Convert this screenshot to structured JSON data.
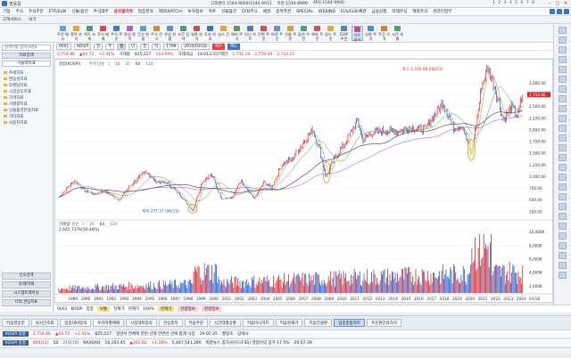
{
  "titlebar": {
    "title": "영웅문",
    "service_info": [
      "고객센터 1544-9000/1544-9911",
      "주문 1544-8989",
      "ARS 1544-9900"
    ],
    "win_numbers": "1 2 3 4 5 6 7 8"
  },
  "menu": [
    "기업",
    "주식",
    "주식주문",
    "ETF/ELW",
    "선물/옵션",
    "주식대주",
    "글로벌마켓",
    "업종분석",
    "해외(KATCH)",
    "투자정보",
    "차트",
    "선물옵션",
    "CFD주식",
    "채권",
    "종목추천",
    "SPECIAL",
    "WEBIND",
    "ELS/ELB/채권",
    "금융상품",
    "미래주식",
    "해외주식",
    "온라인업무"
  ],
  "menu_hot": "글로벌마켓",
  "subbar": [
    "고객서비스",
    "보기"
  ],
  "toolbar": [
    {
      "label": "주간\n메뉴",
      "color": "#6aa0e0"
    },
    {
      "label": "종목\n분석",
      "color": "#e6a13b"
    },
    {
      "label": "차트\n조회",
      "color": "#49a36b"
    },
    {
      "label": "주식\n매매",
      "color": "#d34c4c"
    },
    {
      "label": "주식\n주문",
      "color": "#3d7bd0"
    },
    {
      "label": "관심\n종목",
      "color": "#9b6bd2"
    },
    {
      "label": "잔고\n현황",
      "color": "#5aa5c2"
    },
    {
      "label": "주식\n잔고",
      "color": "#d58a3a"
    },
    {
      "label": "관심\n현황",
      "color": "#5e8fd1"
    },
    {
      "label": "조건\n검색",
      "color": "#48a07a"
    },
    {
      "label": "영웅\n분석",
      "color": "#c35353"
    },
    {
      "label": "투자\n자료",
      "color": "#3f74c4"
    },
    {
      "label": "실시\n간",
      "color": "#e4a43f"
    },
    {
      "label": "해외\n주식",
      "color": "#579a5a"
    },
    {
      "label": "미니\n차트",
      "color": "#4d7ac9"
    },
    {
      "label": "간편\n주문",
      "color": "#cf5252"
    },
    {
      "label": "바로\n주문",
      "color": "#6c8fce"
    },
    {
      "label": "선물\n주문",
      "color": "#d89b3c"
    },
    {
      "label": "옵션\n주문",
      "color": "#4aa17d"
    },
    {
      "label": "해외\n주문",
      "color": "#bb5d5d"
    },
    {
      "label": "골드\n주문",
      "color": "#d6b13f"
    },
    {
      "label": "ELW\n주문",
      "color": "#5a7dc9"
    },
    {
      "label": "차트\n분석",
      "color": "#c84c8a"
    },
    {
      "label": "일봉\n주가",
      "color": "#4a8dd0"
    },
    {
      "label": "주간\n가격",
      "color": "#d17f3a"
    },
    {
      "label": "시간\n대별",
      "color": "#4ea36f"
    }
  ],
  "leftpanel": {
    "search_placeholder": "검색어를 입력하세요",
    "tabs": [
      "지표검색",
      "기술적지표"
    ],
    "tree": [
      "추세지표",
      "변동성지표",
      "모멘텀지표",
      "시장강도지표",
      "가격지표",
      "거래량지표",
      "선물옵션전용지표",
      "기타지표",
      "사용자지표"
    ],
    "bottom": [
      "신호검색",
      "강세/약세",
      "시스템트레이딩",
      "나의 관심지표"
    ]
  },
  "chartheader": {
    "code": "0001",
    "name": "KOSPI",
    "period_buttons": [
      "일",
      "주",
      "월",
      "년",
      "분",
      "틱"
    ],
    "selected_period": "월",
    "count": "1799",
    "date": "2024/03/18",
    "buy": "매수",
    "sell": "매도"
  },
  "quote": {
    "price": "2,754.86",
    "change": "▲64.72",
    "pct": "+2.41%",
    "volume_label": "거래량",
    "volume": "825,227",
    "vol_change": "114.69%",
    "amount_label": "거래대금",
    "amount": "14,013,557백만",
    "high": "2,759.49",
    "low": "2,724.25",
    "open": "2,701.19"
  },
  "chart_data": {
    "type": "line",
    "title": "종합(KOSPI)",
    "legend": [
      "종합(KOSPI)",
      "주가 단순",
      "5",
      "10",
      "20",
      "60",
      "120"
    ],
    "x_ticks": [
      "1989",
      "1990",
      "1991",
      "1992",
      "1993",
      "1994",
      "1995",
      "1996",
      "1997",
      "1998",
      "1999",
      "2000",
      "2001",
      "2002",
      "2003",
      "2004",
      "2005",
      "2006",
      "2007",
      "2008",
      "2009",
      "2010",
      "2011",
      "2012",
      "2013",
      "2014",
      "2015",
      "2016",
      "2017",
      "2018",
      "2019",
      "2020",
      "2021",
      "2022",
      "2023",
      "2024"
    ],
    "y_ticks": [
      "3,000.00",
      "2,750.00",
      "2,500.00",
      "2,250.00",
      "2,000.00",
      "1,750.00",
      "1,500.00",
      "1,250.00",
      "1,000.00",
      "750.00",
      "500.00",
      "250.00"
    ],
    "ylim": [
      150,
      3350
    ],
    "series": [
      {
        "name": "종합(KOSPI)",
        "x": [
          1988.0,
          1989.2,
          1990.0,
          1990.8,
          1991.5,
          1992.7,
          1993.5,
          1994.8,
          1995.5,
          1996.5,
          1997.5,
          1998.45,
          1999.2,
          1999.9,
          2000.7,
          2001.5,
          2002.2,
          2002.9,
          2003.3,
          2004.0,
          2004.6,
          2005.5,
          2006.2,
          2006.8,
          2007.8,
          2008.3,
          2008.85,
          2009.5,
          2010.3,
          2011.3,
          2011.7,
          2012.5,
          2013.5,
          2014.5,
          2015.5,
          2016.5,
          2017.5,
          2018.0,
          2018.8,
          2019.5,
          2020.2,
          2020.7,
          2021.0,
          2021.5,
          2022.0,
          2022.7,
          2023.3,
          2023.8,
          2024.2
        ],
        "values": [
          560,
          920,
          700,
          620,
          700,
          500,
          790,
          1120,
          900,
          860,
          600,
          277,
          900,
          1050,
          540,
          540,
          900,
          630,
          540,
          880,
          760,
          1300,
          1370,
          1620,
          2010,
          1650,
          980,
          1400,
          1700,
          2200,
          1800,
          1950,
          1990,
          1970,
          2050,
          1990,
          2400,
          2580,
          2050,
          2100,
          1460,
          2350,
          2950,
          3316,
          2950,
          2200,
          2500,
          2300,
          2754
        ]
      }
    ],
    "annotations": [
      {
        "text": "최고 3,316.08 (06/21)",
        "color": "#d8262c"
      },
      {
        "text": "최저 277.37 (06/15)",
        "color": "#1d5bd6"
      }
    ],
    "last_price_label": "2,754.86",
    "volume_panel": {
      "legend": [
        "거래량",
        "단순",
        "5",
        "20",
        "60",
        "120"
      ],
      "value_text": "2,645,737K(50.48%)",
      "y_ticks": [
        "10,000K",
        "8,000K",
        "6,000K",
        "4,000K",
        "2,000K"
      ]
    },
    "last_date": "03/18"
  },
  "bottom": {
    "row1": [
      "0001",
      "KOSPI",
      "종합",
      "보통",
      "현재가",
      "현재가",
      "100%"
    ],
    "row1_tags": [
      "현재가",
      "잔량정보",
      "잔량정보"
    ],
    "taskbar": [
      "키움영웅문",
      "실시간조회",
      "업종대비등락",
      "투자자별매매",
      "시장대비등락",
      "관심종목",
      "키움주문",
      "시간대별상황",
      "키움미니차트",
      "키움현재가",
      "키움전광판",
      "업종종합차트",
      "주문판단의지석"
    ],
    "taskbar_active": "업종종합차트",
    "ticker1": [
      "KOSPI 종합",
      "2,754.86",
      "▲64.72",
      "+2.41%",
      "825,227",
      "일반서 전체에 한번 선택 한번만 선택 합계 시장",
      "19:02:35",
      "월일호",
      "상세시"
    ],
    "ticker2": [
      "KOSPI 종합",
      "865(11)",
      "50",
      "219(10)",
      "NASDAQ",
      "16,103.45",
      "▲202.62",
      "+1.28%",
      "5,487,541,280",
      "복합뉴스 참가사이드(FSS) 영업이익 증가 17.5%",
      "20:07:39"
    ]
  },
  "colors": {
    "up": "#d8262c",
    "down": "#1d5bd6",
    "ma5": "#e67a26",
    "ma20": "#2da42d",
    "ma60": "#3b3b3b",
    "ma120": "#a03ad0"
  }
}
